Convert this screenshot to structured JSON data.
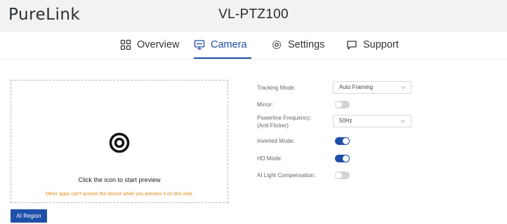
{
  "header": {
    "logo": "PureLink",
    "device": "VL-PTZ100"
  },
  "tabs": [
    {
      "label": "Overview",
      "icon": "grid-icon"
    },
    {
      "label": "Camera",
      "icon": "monitor-icon",
      "active": true
    },
    {
      "label": "Settings",
      "icon": "gear-icon"
    },
    {
      "label": "Support",
      "icon": "chat-icon"
    }
  ],
  "preview": {
    "prompt": "Click the icon to start preview",
    "warning": "Other apps can't access the device while you preview it on this web.",
    "icon": "target-icon"
  },
  "ai_region_button": "AI Region",
  "settings": {
    "tracking_mode": {
      "label": "Tracking Mode:",
      "value": "Auto Framing"
    },
    "mirror": {
      "label": "Mirror:",
      "on": false
    },
    "powerline": {
      "label_line1": "Powerline Frequency:",
      "label_line2": "(Anti Flicker)",
      "value": "50Hz"
    },
    "inverted_mode": {
      "label": "Inverted Mode:",
      "on": true
    },
    "hd_mode": {
      "label": "HD Mode:",
      "on": true
    },
    "ai_light": {
      "label": "AI Light Compensation:",
      "on": false
    }
  },
  "colors": {
    "accent": "#1f4fa8",
    "warning": "#e08b17",
    "header_bg": "#f2f2f2"
  }
}
